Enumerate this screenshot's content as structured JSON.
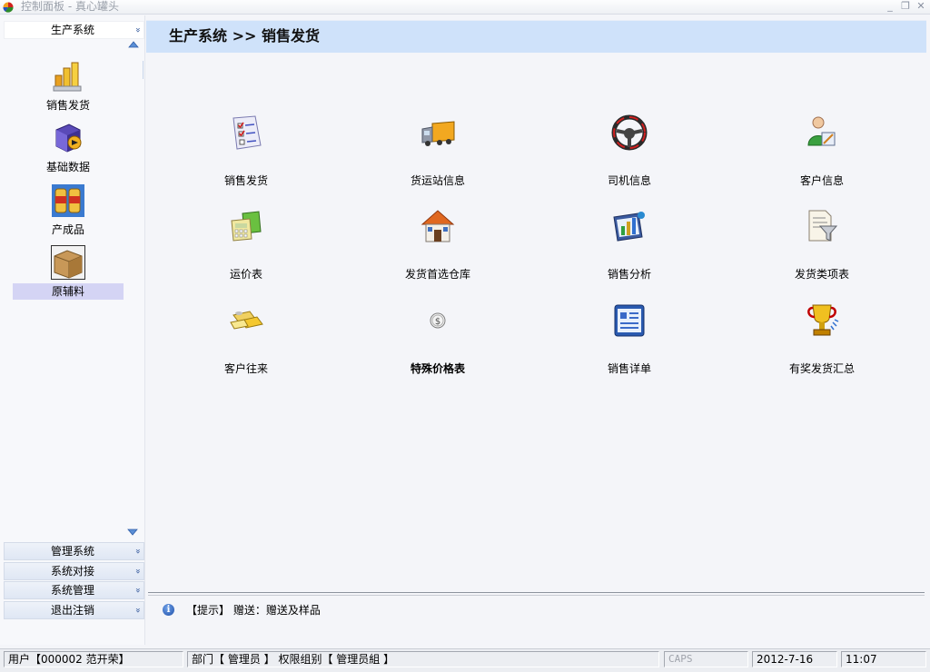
{
  "window": {
    "title": "控制面板 - 真心罐头",
    "minimize": "_",
    "restore": "❐",
    "close": "✕"
  },
  "sidebar": {
    "top_group": {
      "label": "生产系统",
      "arrow": "»"
    },
    "items": [
      {
        "label": "销售发货",
        "icon": "sales-chart-icon"
      },
      {
        "label": "基础数据",
        "icon": "cube-data-icon"
      },
      {
        "label": "产成品",
        "icon": "cans-product-icon"
      },
      {
        "label": "原辅料",
        "icon": "box-material-icon",
        "selected": true
      }
    ],
    "bottom_groups": [
      {
        "label": "管理系统",
        "arrow": "»"
      },
      {
        "label": "系统对接",
        "arrow": "»"
      },
      {
        "label": "系统管理",
        "arrow": "»"
      },
      {
        "label": "退出注销",
        "arrow": "»"
      }
    ]
  },
  "breadcrumb": {
    "text": "生产系统  >>  销售发货"
  },
  "tiles": [
    {
      "label": "销售发货",
      "icon": "checklist-icon"
    },
    {
      "label": "货运站信息",
      "icon": "truck-icon"
    },
    {
      "label": "司机信息",
      "icon": "steering-wheel-icon"
    },
    {
      "label": "客户信息",
      "icon": "customer-icon"
    },
    {
      "label": "运价表",
      "icon": "calculator-icon"
    },
    {
      "label": "发货首选仓库",
      "icon": "warehouse-icon"
    },
    {
      "label": "销售分析",
      "icon": "analysis-chart-icon"
    },
    {
      "label": "发货类项表",
      "icon": "filter-doc-icon"
    },
    {
      "label": "客户往来",
      "icon": "gold-cards-icon"
    },
    {
      "label": "特殊价格表",
      "icon": "coin-icon",
      "bold": true
    },
    {
      "label": "销售详单",
      "icon": "detail-list-icon"
    },
    {
      "label": "有奖发货汇总",
      "icon": "trophy-icon"
    }
  ],
  "hint": {
    "icon": "info-icon",
    "text": "【提示】 赠送：赠送及样品"
  },
  "statusbar": {
    "user": "用户【000002 范开荣】",
    "dept": "部门【 管理员 】 权限组别【 管理员組 】",
    "caps": "CAPS",
    "date": "2012-7-16",
    "time": "11:07"
  }
}
